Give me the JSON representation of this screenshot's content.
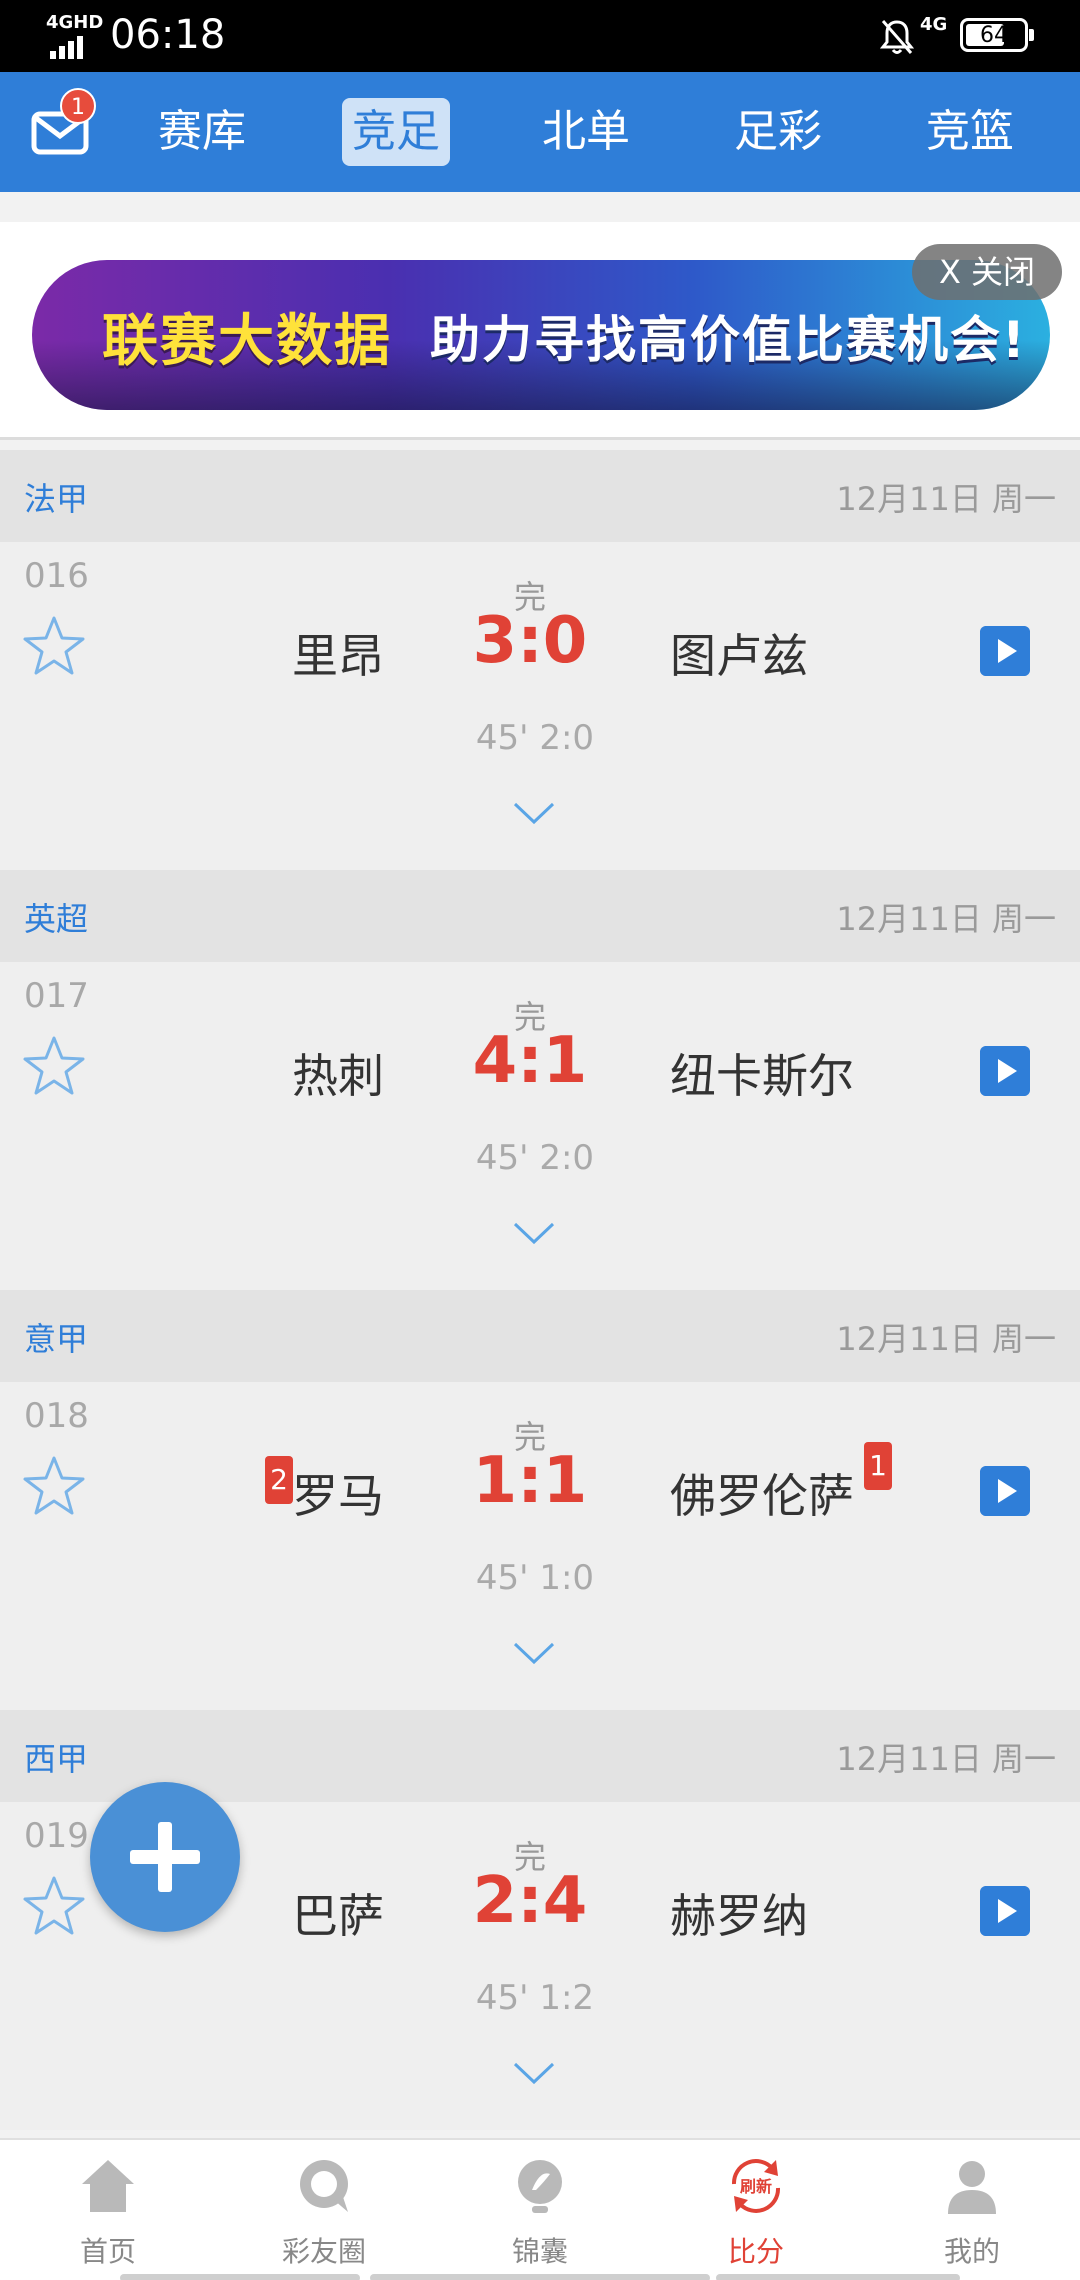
{
  "status_bar": {
    "network": "4GHD",
    "time": "06:18",
    "signal_type": "4G",
    "battery": "64"
  },
  "top_nav": {
    "mail_badge": "1",
    "tabs": [
      {
        "label": "赛库"
      },
      {
        "label": "竞足",
        "active": true
      },
      {
        "label": "北单"
      },
      {
        "label": "足彩"
      },
      {
        "label": "竞篮"
      }
    ]
  },
  "banner": {
    "title_yellow": "联赛大数据",
    "title_white": "助力寻找高价值比赛机会!",
    "close_label": "X 关闭"
  },
  "leagues": [
    {
      "name": "法甲",
      "date": "12月11日 周一",
      "match": {
        "num": "016",
        "home": "里昂",
        "status": "完",
        "score": "3:0",
        "away": "图卢兹",
        "half": "45' 2:0"
      }
    },
    {
      "name": "英超",
      "date": "12月11日 周一",
      "match": {
        "num": "017",
        "home": "热刺",
        "status": "完",
        "score": "4:1",
        "away": "纽卡斯尔",
        "half": "45' 2:0"
      }
    },
    {
      "name": "意甲",
      "date": "12月11日 周一",
      "match": {
        "num": "018",
        "home": "罗马",
        "status": "完",
        "score": "1:1",
        "away": "佛罗伦萨",
        "half": "45' 1:0",
        "home_red_cards": "2",
        "away_red_cards": "1"
      }
    },
    {
      "name": "西甲",
      "date": "12月11日 周一",
      "match": {
        "num": "019",
        "home": "巴萨",
        "status": "完",
        "score": "2:4",
        "away": "赫罗纳",
        "half": "45' 1:2"
      }
    }
  ],
  "bottom_nav": [
    {
      "label": "首页",
      "icon": "home-icon"
    },
    {
      "label": "彩友圈",
      "icon": "chat-icon"
    },
    {
      "label": "锦囊",
      "icon": "tips-icon"
    },
    {
      "label": "比分",
      "icon": "refresh-icon",
      "icon_text": "刷新",
      "active": true
    },
    {
      "label": "我的",
      "icon": "user-icon"
    }
  ],
  "colors": {
    "brand_blue": "#2f7ed8",
    "score_red": "#e04236",
    "badge_red": "#e74c3c"
  }
}
